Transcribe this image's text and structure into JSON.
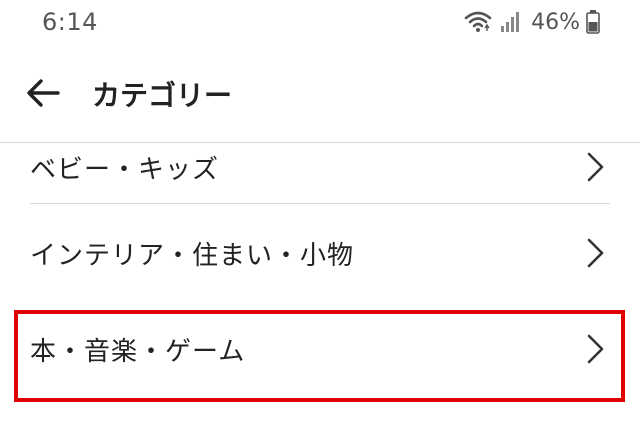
{
  "status_bar": {
    "time": "6:14",
    "battery": "46%",
    "icons": [
      "wifi-icon",
      "signal-icon",
      "battery-icon"
    ]
  },
  "app_bar": {
    "back_icon": "arrow-left-icon",
    "title": "カテゴリー"
  },
  "categories": [
    {
      "label": "ベビー・キッズ",
      "icon": "chevron-right-icon"
    },
    {
      "label": "インテリア・住まい・小物",
      "icon": "chevron-right-icon"
    },
    {
      "label": "本・音楽・ゲーム",
      "icon": "chevron-right-icon",
      "highlighted": true
    }
  ],
  "colors": {
    "highlight": "#e00000",
    "divider": "#d7d7d7",
    "text": "#222222",
    "status_text": "#555555"
  }
}
